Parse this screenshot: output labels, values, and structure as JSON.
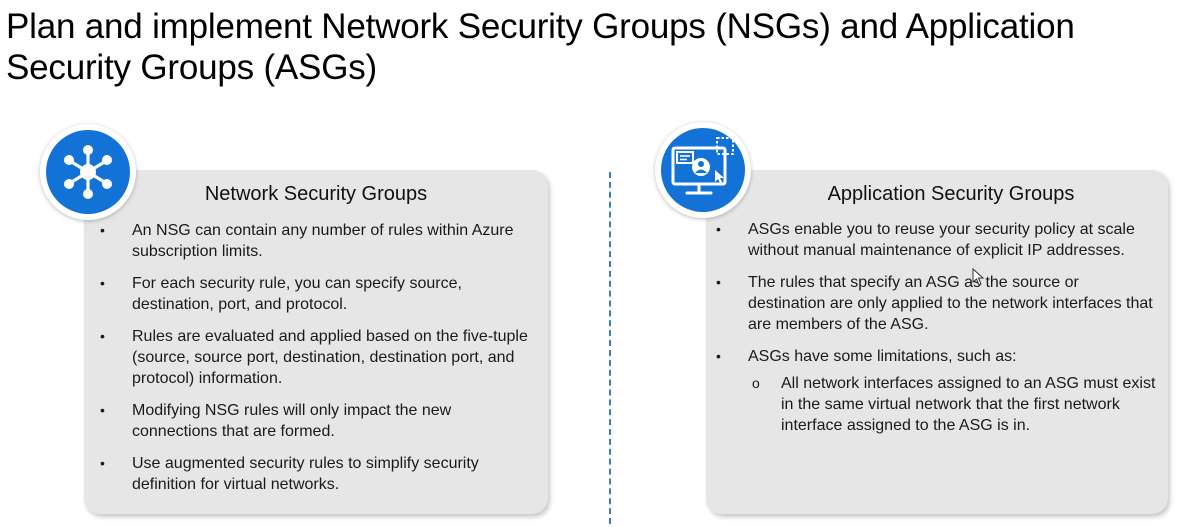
{
  "slide": {
    "title": "Plan and implement Network Security Groups (NSGs) and Application Security Groups (ASGs)"
  },
  "nsg": {
    "icon": "network-hub-icon",
    "heading": "Network Security Groups",
    "bullets": [
      "An NSG can contain any number of rules within Azure subscription limits.",
      "For each security rule, you can specify source, destination, port, and protocol.",
      "Rules are evaluated and applied based on the five-tuple (source, source port, destination, destination port, and protocol) information.",
      "Modifying NSG rules will only impact the new connections that are formed.",
      "Use augmented security rules to simplify security definition for virtual networks."
    ]
  },
  "asg": {
    "icon": "application-monitor-icon",
    "heading": "Application Security Groups",
    "bullets": [
      "ASGs enable you to reuse your security policy at scale without manual maintenance of explicit IP addresses.",
      "The rules that specify an ASG as the source or destination are only applied to the network interfaces that are members of the ASG.",
      "ASGs have some limitations, such as:"
    ],
    "sub_bullets": [
      "All network interfaces assigned to an ASG must exist in the same virtual network that the first network interface assigned to the ASG is in."
    ]
  },
  "colors": {
    "accent": "#1372d6",
    "card": "#e6e6e6",
    "divider": "#3a7fc1"
  }
}
